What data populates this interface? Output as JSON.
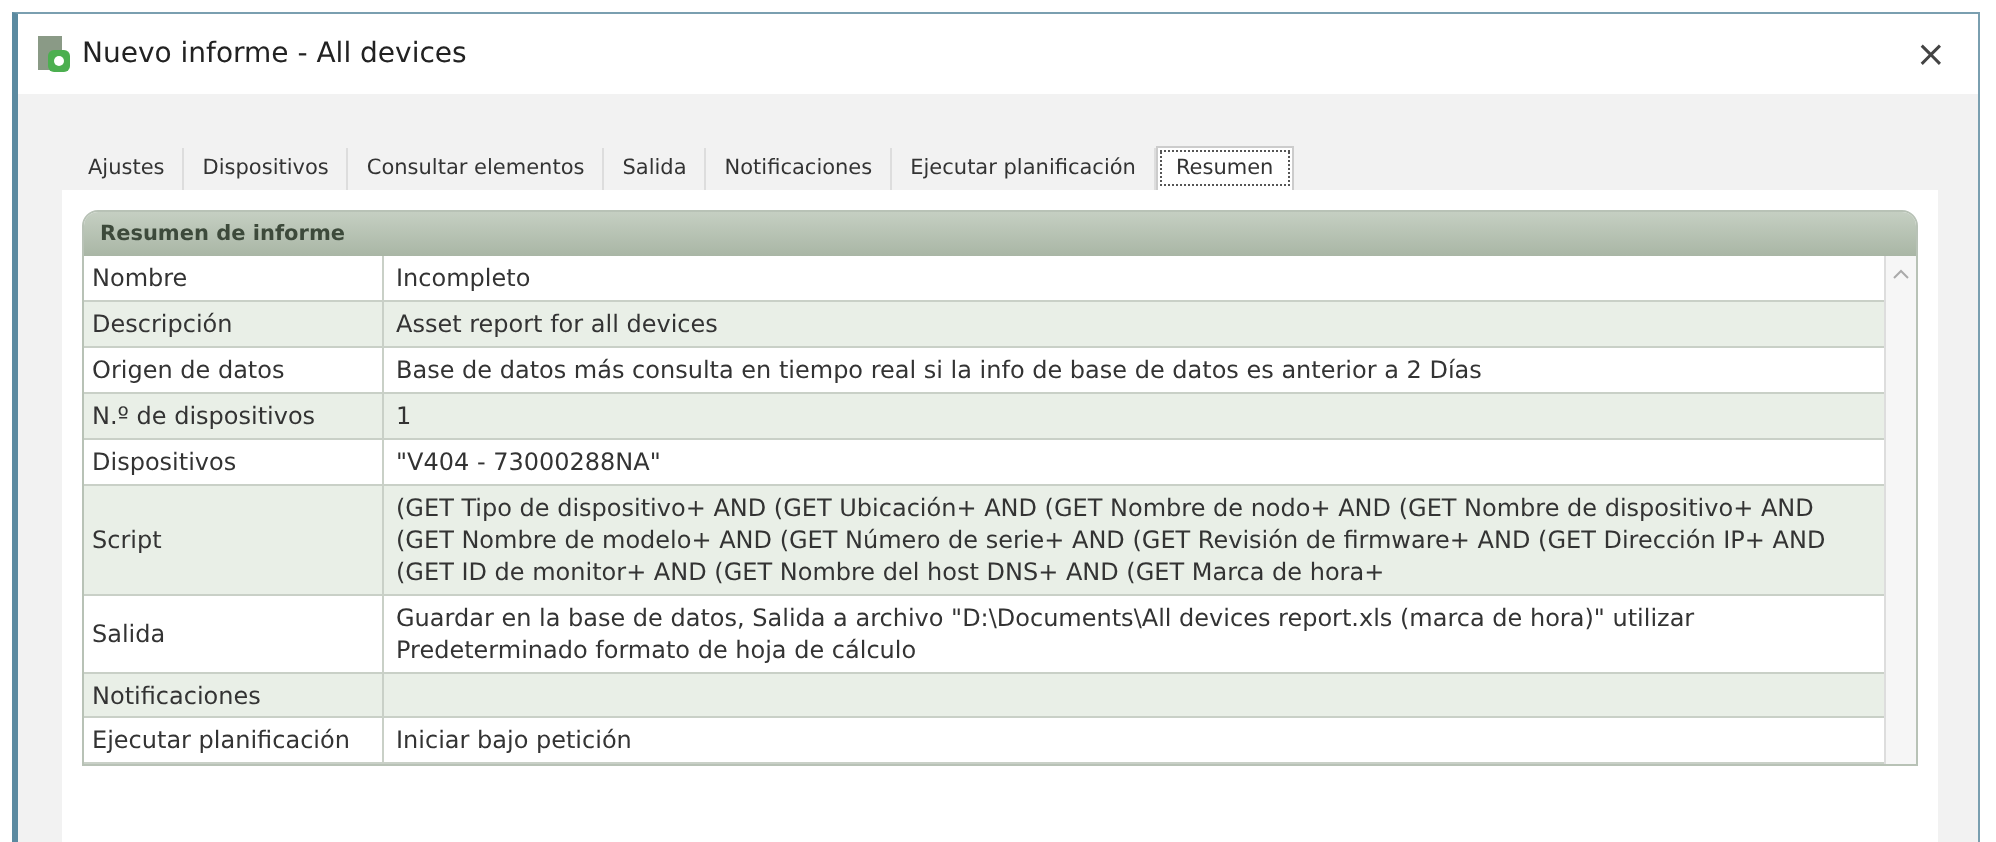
{
  "window": {
    "title": "Nuevo informe - All devices",
    "close": "×"
  },
  "tabs": [
    {
      "label": "Ajustes",
      "selected": false
    },
    {
      "label": "Dispositivos",
      "selected": false
    },
    {
      "label": "Consultar elementos",
      "selected": false
    },
    {
      "label": "Salida",
      "selected": false
    },
    {
      "label": "Notificaciones",
      "selected": false
    },
    {
      "label": "Ejecutar planificación",
      "selected": false
    },
    {
      "label": "Resumen",
      "selected": true
    }
  ],
  "summary": {
    "title": "Resumen de informe",
    "rows": [
      {
        "label": "Nombre",
        "value": "Incompleto"
      },
      {
        "label": "Descripción",
        "value": "Asset report for all devices"
      },
      {
        "label": "Origen de datos",
        "value": "Base de datos más consulta en tiempo real si la info de base de datos es anterior a 2 Días"
      },
      {
        "label": "N.º de dispositivos",
        "value": "1"
      },
      {
        "label": "Dispositivos",
        "value": "\"V404 - 73000288NA\""
      },
      {
        "label": "Script",
        "value": "(GET Tipo de dispositivo+ AND (GET Ubicación+ AND (GET Nombre de nodo+ AND (GET Nombre de dispositivo+ AND (GET Nombre de modelo+ AND (GET Número de serie+ AND (GET Revisión de firmware+ AND (GET Dirección IP+ AND (GET ID de monitor+ AND (GET Nombre del host DNS+ AND (GET Marca de hora+"
      },
      {
        "label": "Salida",
        "value": "Guardar en la base de datos, Salida a archivo \"D:\\Documents\\All devices report.xls (marca de hora)\" utilizar Predeterminado formato de hoja de cálculo"
      },
      {
        "label": "Notificaciones"
      },
      {
        "label": "Ejecutar planificación",
        "value": "Iniciar bajo petición"
      }
    ]
  }
}
